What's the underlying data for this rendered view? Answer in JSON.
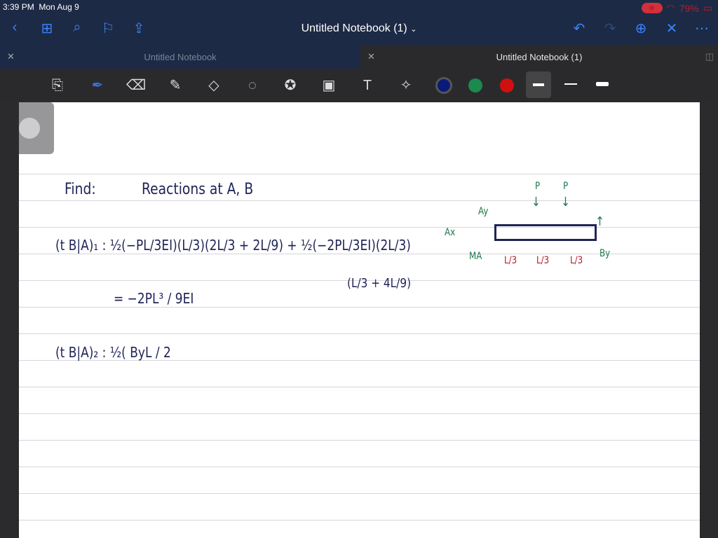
{
  "status": {
    "time": "3:39 PM",
    "date": "Mon Aug 9",
    "battery": "79%"
  },
  "nav": {
    "title": "Untitled Notebook (1)",
    "chevron": "⌄"
  },
  "tabs": [
    {
      "label": "Untitled Notebook",
      "active": false
    },
    {
      "label": "Untitled Notebook (1)",
      "active": true
    }
  ],
  "tools": [
    "page-tool",
    "pen",
    "eraser",
    "highlighter",
    "shapes",
    "lasso",
    "sticker",
    "image",
    "text",
    "laser"
  ],
  "colors": {
    "navy": "#0a1a78",
    "green": "#1a8a4e",
    "red": "#d01010"
  },
  "notes": {
    "find": "Find:",
    "reactions": "Reactions  at   A, B",
    "eq1": "(t B|A)₁ : ½(−PL/3EI)(L/3)(2L/3 + 2L/9) + ½(−2PL/3EI)(2L/3)",
    "eq1b": "(L/3 + 4L/9)",
    "eq2": "= −2PL³ / 9EI",
    "eq3": "(t B|A)₂ :  ½( ByL / 2",
    "diagram": {
      "p1": "P",
      "p2": "P",
      "ay": "Ay",
      "ax": "Ax",
      "ma": "MA",
      "by": "By",
      "seg1": "L/3",
      "seg2": "L/3",
      "seg3": "L/3"
    }
  }
}
